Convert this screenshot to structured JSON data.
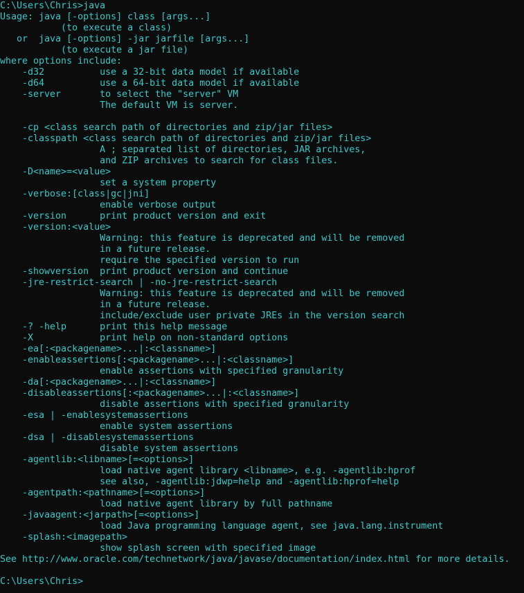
{
  "terminal": {
    "text_color": "#3ac8c8",
    "background_color": "#0c0c0c",
    "lines": [
      "C:\\Users\\Chris>java",
      "Usage: java [-options] class [args...]",
      "           (to execute a class)",
      "   or  java [-options] -jar jarfile [args...]",
      "           (to execute a jar file)",
      "where options include:",
      "    -d32          use a 32-bit data model if available",
      "    -d64          use a 64-bit data model if available",
      "    -server       to select the \"server\" VM",
      "                  The default VM is server.",
      "",
      "    -cp <class search path of directories and zip/jar files>",
      "    -classpath <class search path of directories and zip/jar files>",
      "                  A ; separated list of directories, JAR archives,",
      "                  and ZIP archives to search for class files.",
      "    -D<name>=<value>",
      "                  set a system property",
      "    -verbose:[class|gc|jni]",
      "                  enable verbose output",
      "    -version      print product version and exit",
      "    -version:<value>",
      "                  Warning: this feature is deprecated and will be removed",
      "                  in a future release.",
      "                  require the specified version to run",
      "    -showversion  print product version and continue",
      "    -jre-restrict-search | -no-jre-restrict-search",
      "                  Warning: this feature is deprecated and will be removed",
      "                  in a future release.",
      "                  include/exclude user private JREs in the version search",
      "    -? -help      print this help message",
      "    -X            print help on non-standard options",
      "    -ea[:<packagename>...|:<classname>]",
      "    -enableassertions[:<packagename>...|:<classname>]",
      "                  enable assertions with specified granularity",
      "    -da[:<packagename>...|:<classname>]",
      "    -disableassertions[:<packagename>...|:<classname>]",
      "                  disable assertions with specified granularity",
      "    -esa | -enablesystemassertions",
      "                  enable system assertions",
      "    -dsa | -disablesystemassertions",
      "                  disable system assertions",
      "    -agentlib:<libname>[=<options>]",
      "                  load native agent library <libname>, e.g. -agentlib:hprof",
      "                  see also, -agentlib:jdwp=help and -agentlib:hprof=help",
      "    -agentpath:<pathname>[=<options>]",
      "                  load native agent library by full pathname",
      "    -javaagent:<jarpath>[=<options>]",
      "                  load Java programming language agent, see java.lang.instrument",
      "    -splash:<imagepath>",
      "                  show splash screen with specified image",
      "See http://www.oracle.com/technetwork/java/javase/documentation/index.html for more details.",
      "",
      "C:\\Users\\Chris>"
    ]
  }
}
